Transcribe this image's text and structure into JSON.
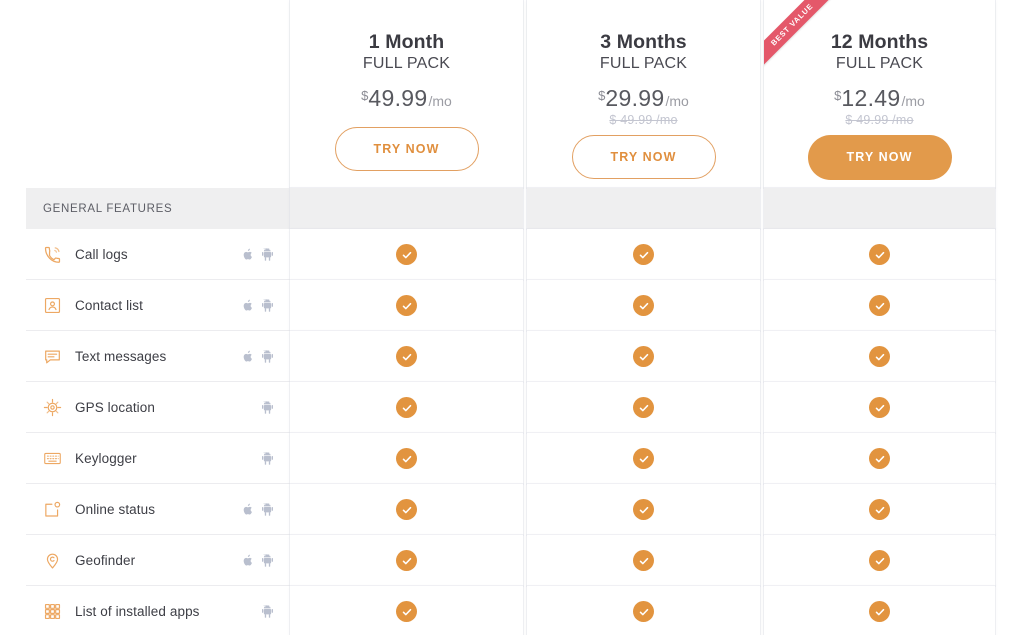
{
  "plans": [
    {
      "id": "plan-1-month",
      "title": "1 Month",
      "subtitle": "FULL PACK",
      "currency": "$",
      "amount": "49.99",
      "period": "/mo",
      "old_price": "",
      "cta": "TRY NOW",
      "badge": "",
      "highlight": false
    },
    {
      "id": "plan-3-months",
      "title": "3 Months",
      "subtitle": "FULL PACK",
      "currency": "$",
      "amount": "29.99",
      "period": "/mo",
      "old_price": "$ 49.99 /mo",
      "cta": "TRY NOW",
      "badge": "",
      "highlight": false
    },
    {
      "id": "plan-12-months",
      "title": "12 Months",
      "subtitle": "FULL PACK",
      "currency": "$",
      "amount": "12.49",
      "period": "/mo",
      "old_price": "$ 49.99 /mo",
      "cta": "TRY NOW",
      "badge": "BEST VALUE",
      "highlight": true
    }
  ],
  "section": {
    "label": "GENERAL FEATURES"
  },
  "features": [
    {
      "label": "Call logs",
      "icon": "phone-call-icon",
      "ios": true,
      "android": true,
      "included": [
        true,
        true,
        true
      ]
    },
    {
      "label": "Contact list",
      "icon": "contact-card-icon",
      "ios": true,
      "android": true,
      "included": [
        true,
        true,
        true
      ]
    },
    {
      "label": "Text messages",
      "icon": "chat-bubble-icon",
      "ios": true,
      "android": true,
      "included": [
        true,
        true,
        true
      ]
    },
    {
      "label": "GPS location",
      "icon": "gps-target-icon",
      "ios": false,
      "android": true,
      "included": [
        true,
        true,
        true
      ]
    },
    {
      "label": "Keylogger",
      "icon": "keyboard-icon",
      "ios": false,
      "android": true,
      "included": [
        true,
        true,
        true
      ]
    },
    {
      "label": "Online status",
      "icon": "online-status-icon",
      "ios": true,
      "android": true,
      "included": [
        true,
        true,
        true
      ]
    },
    {
      "label": "Geofinder",
      "icon": "map-pin-icon",
      "ios": true,
      "android": true,
      "included": [
        true,
        true,
        true
      ]
    },
    {
      "label": "List of installed apps",
      "icon": "app-grid-icon",
      "ios": false,
      "android": true,
      "included": [
        true,
        true,
        true
      ]
    }
  ],
  "colors": {
    "accent": "#e2943f",
    "accent_light": "#eda863",
    "ribbon": "#e4586a",
    "band": "#efeff0",
    "text": "#3d3e45",
    "platform": "#b9bfce"
  }
}
